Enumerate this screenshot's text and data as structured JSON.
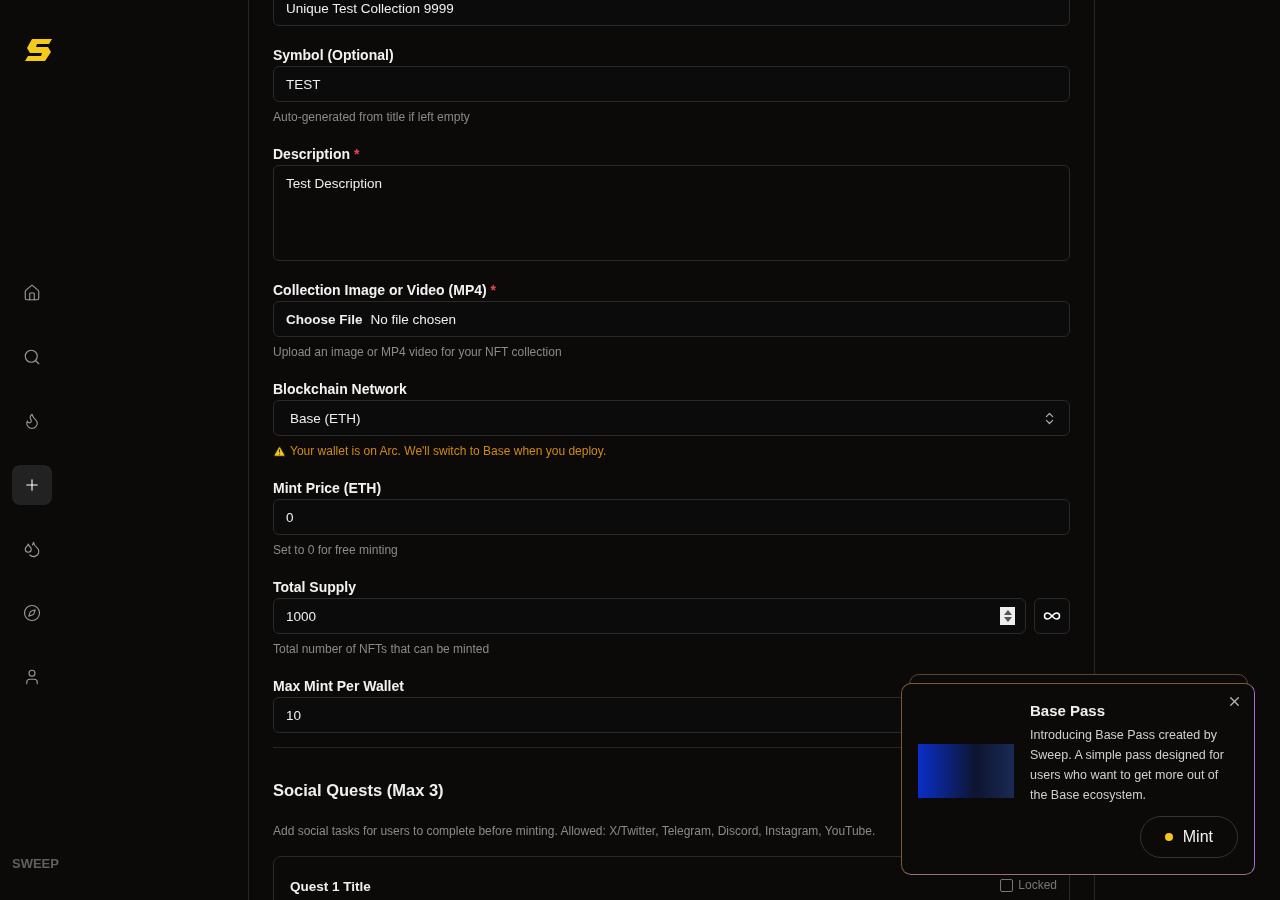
{
  "sidebar": {
    "nav": [
      {
        "selected": false
      },
      {
        "selected": false
      },
      {
        "selected": false
      },
      {
        "selected": true
      },
      {
        "selected": false
      },
      {
        "selected": false
      },
      {
        "selected": false
      }
    ],
    "brand": "SWEEP"
  },
  "form": {
    "fields": [
      {
        "kind": "text",
        "value": "Unique Test Collection 9999"
      },
      {
        "kind": "text",
        "label": "Symbol (Optional)",
        "value": "TEST",
        "hint": "Auto-generated from title if left empty"
      },
      {
        "kind": "textarea",
        "label": "Description",
        "required_mark": "*",
        "value": "Test Description"
      },
      {
        "kind": "file",
        "label": "Collection Image or Video (MP4)",
        "required_mark": "*",
        "button": "Choose File",
        "value": "No file chosen",
        "hint": "Upload an image or MP4 video for your NFT collection"
      },
      {
        "kind": "select",
        "label": "Blockchain Network",
        "value": "Base (ETH)",
        "warning": "Your wallet is on Arc. We'll switch to Base when you deploy."
      },
      {
        "kind": "text",
        "label": "Mint Price (ETH)",
        "value": "0",
        "hint": "Set to 0 for free minting"
      },
      {
        "kind": "number",
        "label": "Total Supply",
        "value": "1000",
        "hint": "Total number of NFTs that can be minted"
      },
      {
        "kind": "text",
        "label": "Max Mint Per Wallet",
        "value": "10"
      }
    ],
    "quests": {
      "title": "Social Quests (Max 3)",
      "description": "Add social tasks for users to complete before minting. Allowed: X/Twitter, Telegram, Discord, Instagram, YouTube.",
      "items": [
        {
          "title": "Quest 1 Title",
          "locked_label": "Locked",
          "locked": false
        }
      ]
    }
  },
  "popup": {
    "title": "Base Pass",
    "body": "Introducing Base Pass created by Sweep. A simple pass designed for users who want to get more out of the Base ecosystem.",
    "button": "Mint"
  }
}
